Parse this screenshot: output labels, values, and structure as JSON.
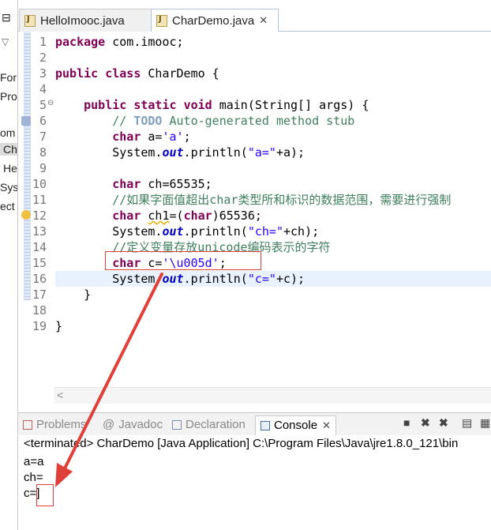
{
  "left_panel": {
    "items": [
      "⊟",
      "For",
      "Pro",
      "om",
      "Ch",
      "He",
      "Sys",
      "ect"
    ]
  },
  "editor_tabs": [
    {
      "label": "HelloImooc.java",
      "active": false
    },
    {
      "label": "CharDemo.java",
      "active": true,
      "close": "✕"
    }
  ],
  "code": {
    "line_numbers": [
      "1",
      "2",
      "3",
      "4",
      "5",
      "6",
      "7",
      "8",
      "9",
      "10",
      "11",
      "12",
      "13",
      "14",
      "15",
      "16",
      "17",
      "18",
      "19"
    ],
    "l1_kw": "package",
    "l1_rest": " com.imooc;",
    "l3_kw1": "public",
    "l3_kw2": "class",
    "l3_rest": " CharDemo {",
    "l5_kw1": "public",
    "l5_kw2": "static",
    "l5_kw3": "void",
    "l5_rest": " main(String[] args) {",
    "l6_c1": "// ",
    "l6_todo": "TODO",
    "l6_c2": " Auto-generated method stub",
    "l7_kw": "char",
    "l7_a": " a=",
    "l7_str": "'a'",
    "l7_end": ";",
    "l8_a": "System.",
    "l8_fld": "out",
    "l8_b": ".println(",
    "l8_str": "\"a=\"",
    "l8_c": "+a);",
    "l10_kw": "char",
    "l10_rest": " ch=65535;",
    "l11_comment": "//如果字面值超出char类型所和标识的数据范围，需要进行强制",
    "l12_kw": "char",
    "l12_a": " ",
    "l12_var": "ch1",
    "l12_b": "=(",
    "l12_kw2": "char",
    "l12_c": ")65536;",
    "l13_a": "System.",
    "l13_fld": "out",
    "l13_b": ".println(",
    "l13_str": "\"ch=\"",
    "l13_c": "+ch);",
    "l14_comment": "//定义变量存放unicode编码表示的字符",
    "l15_kw": "char",
    "l15_a": " c=",
    "l15_str": "'\\u005d'",
    "l15_end": ";",
    "l16_a": "System.",
    "l16_fld": "out",
    "l16_b": ".println(",
    "l16_str": "\"c=\"",
    "l16_c": "+c);",
    "l17": "}",
    "l19": "}",
    "scroll_arrow": "<"
  },
  "console_tabs": {
    "problems": "Problems",
    "javadoc": "Javadoc",
    "declaration": "Declaration",
    "console": "Console",
    "console_close": "✕",
    "javadoc_icon": "@"
  },
  "console": {
    "header": "<terminated> CharDemo [Java Application] C:\\Program Files\\Java\\jre1.8.0_121\\bin",
    "out1": "a=a",
    "out2": "ch=",
    "out3": "c=]"
  },
  "colors": {
    "keyword": "#7f0055",
    "comment": "#3f7f5f",
    "string": "#2a00ff",
    "annotation_red": "#e0403a"
  }
}
